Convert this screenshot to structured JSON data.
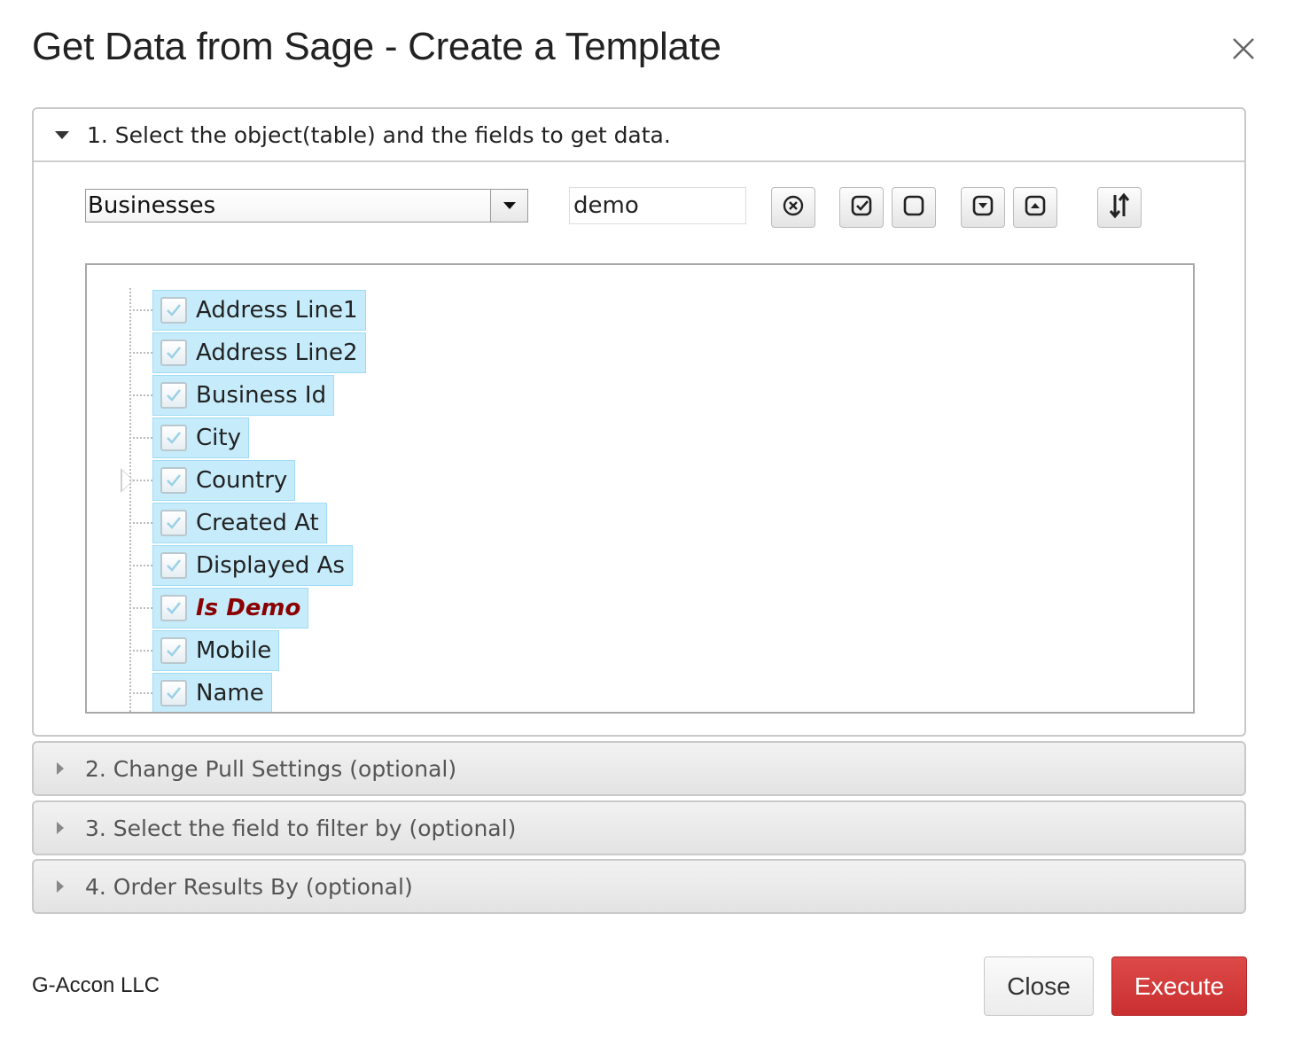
{
  "dialog": {
    "title": "Get Data from Sage - Create a Template"
  },
  "sections": {
    "s1": {
      "title": "1. Select the object(table) and the fields to get data."
    },
    "s2": {
      "title": "2. Change Pull Settings (optional)"
    },
    "s3": {
      "title": "3. Select the field to filter by (optional)"
    },
    "s4": {
      "title": "4. Order Results By (optional)"
    }
  },
  "toolbar": {
    "object_value": "Businesses",
    "search_value": "demo",
    "icons": [
      "clear-icon",
      "check-all-icon",
      "uncheck-all-icon",
      "expand-all-icon",
      "collapse-all-icon",
      "sort-icon"
    ]
  },
  "tree": {
    "items": [
      {
        "label": "Address Line1",
        "checked": true
      },
      {
        "label": "Address Line2",
        "checked": true
      },
      {
        "label": "Business Id",
        "checked": true
      },
      {
        "label": "City",
        "checked": true
      },
      {
        "label": "Country",
        "checked": true
      },
      {
        "label": "Created At",
        "checked": true
      },
      {
        "label": "Displayed As",
        "checked": true
      },
      {
        "label": "Is Demo",
        "checked": true
      },
      {
        "label": "Mobile",
        "checked": true
      },
      {
        "label": "Name",
        "checked": true
      }
    ]
  },
  "footer": {
    "brand": "G-Accon LLC",
    "close_label": "Close",
    "execute_label": "Execute"
  },
  "colors": {
    "accent_execute": "#d33b3a",
    "node_highlight_bg": "#c6ecfb",
    "match_text": "#8b0000"
  }
}
